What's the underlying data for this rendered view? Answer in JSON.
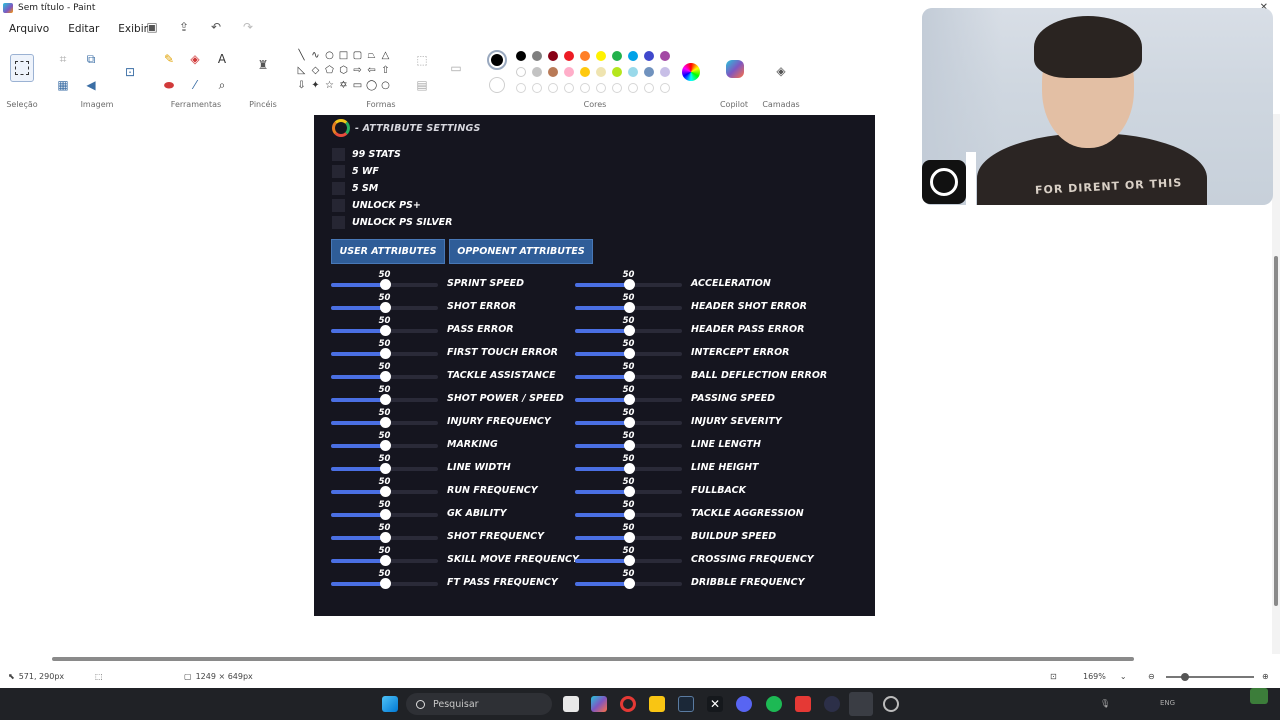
{
  "window": {
    "title": "Sem título - Paint"
  },
  "menu": [
    "Arquivo",
    "Editar",
    "Exibir"
  ],
  "ribbon": {
    "groups": {
      "selecao": "Seleção",
      "imagem": "Imagem",
      "ferramentas": "Ferramentas",
      "pinceis": "Pincéis",
      "formas": "Formas",
      "cores": "Cores",
      "copilot": "Copilot",
      "camadas": "Camadas"
    },
    "colors_row1": [
      "#000000",
      "#7f7f7f",
      "#880015",
      "#ed1c24",
      "#ff7f27",
      "#fff200",
      "#22b14c",
      "#00a2e8",
      "#3f48cc",
      "#a349a4"
    ],
    "colors_row2": [
      "#ffffff",
      "#c3c3c3",
      "#b97a57",
      "#ffaec9",
      "#ffc90e",
      "#efe4b0",
      "#b5e61d",
      "#99d9ea",
      "#7092be",
      "#c8bfe7"
    ]
  },
  "game": {
    "header": "- ATTRIBUTE SETTINGS",
    "options": [
      "99 STATS",
      "5 WF",
      "5 SM",
      "UNLOCK PS+",
      "UNLOCK PS SILVER"
    ],
    "tabs": {
      "user": "USER ATTRIBUTES",
      "opponent": "OPPONENT ATTRIBUTES"
    },
    "slider_fraction": 0.5,
    "left_column": [
      {
        "label": "SPRINT SPEED",
        "value": "50"
      },
      {
        "label": "SHOT ERROR",
        "value": "50"
      },
      {
        "label": "PASS ERROR",
        "value": "50"
      },
      {
        "label": "FIRST TOUCH ERROR",
        "value": "50"
      },
      {
        "label": "TACKLE ASSISTANCE",
        "value": "50"
      },
      {
        "label": "SHOT POWER / SPEED",
        "value": "50"
      },
      {
        "label": "INJURY FREQUENCY",
        "value": "50"
      },
      {
        "label": "MARKING",
        "value": "50"
      },
      {
        "label": "LINE WIDTH",
        "value": "50"
      },
      {
        "label": "RUN FREQUENCY",
        "value": "50"
      },
      {
        "label": "GK ABILITY",
        "value": "50"
      },
      {
        "label": "SHOT FREQUENCY",
        "value": "50"
      },
      {
        "label": "SKILL MOVE FREQUENCY",
        "value": "50"
      },
      {
        "label": "FT PASS FREQUENCY",
        "value": "50"
      }
    ],
    "right_column": [
      {
        "label": "ACCELERATION",
        "value": "50"
      },
      {
        "label": "HEADER SHOT ERROR",
        "value": "50"
      },
      {
        "label": "HEADER PASS ERROR",
        "value": "50"
      },
      {
        "label": "INTERCEPT ERROR",
        "value": "50"
      },
      {
        "label": "BALL DEFLECTION ERROR",
        "value": "50"
      },
      {
        "label": "PASSING SPEED",
        "value": "50"
      },
      {
        "label": "INJURY SEVERITY",
        "value": "50"
      },
      {
        "label": "LINE LENGTH",
        "value": "50"
      },
      {
        "label": "LINE HEIGHT",
        "value": "50"
      },
      {
        "label": "FULLBACK",
        "value": "50"
      },
      {
        "label": "TACKLE AGGRESSION",
        "value": "50"
      },
      {
        "label": "BUILDUP SPEED",
        "value": "50"
      },
      {
        "label": "CROSSING FREQUENCY",
        "value": "50"
      },
      {
        "label": "DRIBBLE FREQUENCY",
        "value": "50"
      }
    ]
  },
  "webcam": {
    "shirt_text": "FOR DIRENT OR THIS"
  },
  "status": {
    "cursor": "571, 290px",
    "image_size": "1249 × 649px",
    "zoom": "169%"
  },
  "taskbar": {
    "search_placeholder": "Pesquisar",
    "language": "ENG"
  }
}
